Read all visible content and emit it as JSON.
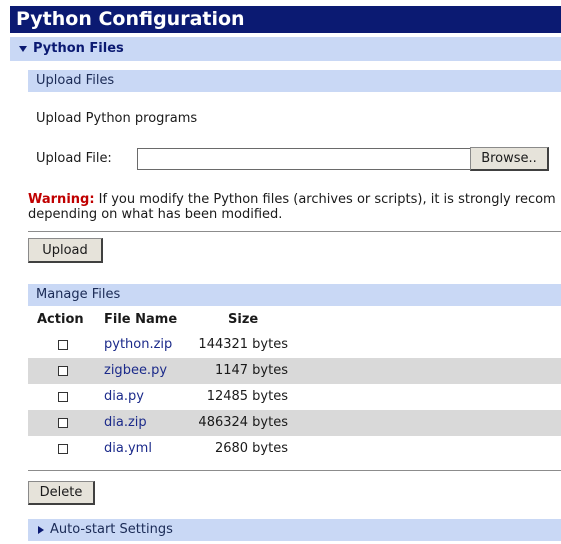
{
  "page": {
    "title": "Python Configuration"
  },
  "python_files": {
    "label": "Python Files",
    "upload": {
      "header": "Upload Files",
      "description": "Upload Python programs",
      "file_label": "Upload File:",
      "file_value": "",
      "browse_label": "Browse..",
      "warning_label": "Warning:",
      "warning_line1": "If you modify the Python files (archives or scripts), it is strongly recom",
      "warning_line2": "depending on what has been modified.",
      "upload_label": "Upload"
    },
    "manage": {
      "header": "Manage Files",
      "columns": {
        "action": "Action",
        "file_name": "File Name",
        "size": "Size"
      },
      "files": [
        {
          "name": "python.zip",
          "size": "144321 bytes",
          "checked": false
        },
        {
          "name": "zigbee.py",
          "size": "1147 bytes",
          "checked": false
        },
        {
          "name": "dia.py",
          "size": "12485 bytes",
          "checked": false
        },
        {
          "name": "dia.zip",
          "size": "486324 bytes",
          "checked": false
        },
        {
          "name": "dia.yml",
          "size": "2680 bytes",
          "checked": false
        }
      ],
      "delete_label": "Delete"
    }
  },
  "autostart": {
    "label": "Auto-start Settings"
  },
  "colors": {
    "header_bg": "#0b1a72",
    "section_bg": "#c9d8f5",
    "warning": "#c00000",
    "link": "#1b2a8a",
    "row_shade": "#d9d9d9"
  }
}
